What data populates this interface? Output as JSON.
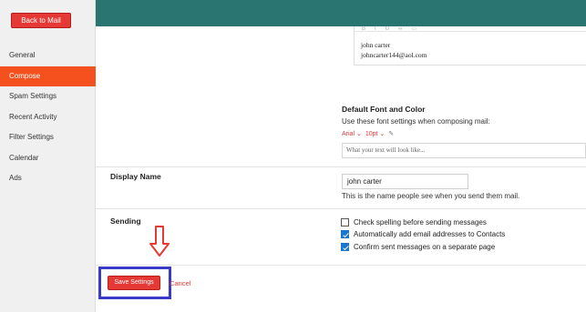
{
  "sidebar": {
    "back_label": "Back to Mail",
    "items": [
      {
        "label": "General"
      },
      {
        "label": "Compose"
      },
      {
        "label": "Spam Settings"
      },
      {
        "label": "Recent Activity"
      },
      {
        "label": "Filter Settings"
      },
      {
        "label": "Calendar"
      },
      {
        "label": "Ads"
      }
    ],
    "active_item": "Compose"
  },
  "signature": {
    "line1": "john carter",
    "line2": "johncarter144@aol.com"
  },
  "default_font": {
    "title": "Default Font and Color",
    "description": "Use these font settings when composing mail:",
    "font": "Arial",
    "size": "10pt",
    "preview": "What your text will look like..."
  },
  "display_name": {
    "label": "Display Name",
    "value": "john carter",
    "help": "This is the name people see when you send them mail."
  },
  "sending": {
    "label": "Sending",
    "options": [
      {
        "label": "Check spelling before sending messages",
        "checked": false
      },
      {
        "label": "Automatically add email addresses to Contacts",
        "checked": true
      },
      {
        "label": "Confirm sent messages on a separate page",
        "checked": true
      }
    ]
  },
  "actions": {
    "save_label": "Save Settings",
    "cancel_label": "Cancel"
  },
  "colors": {
    "accent": "#e53935",
    "header": "#2a7471",
    "active_nav": "#f4511e",
    "highlight_box": "#3a3ac8",
    "checkbox": "#1976d2"
  }
}
